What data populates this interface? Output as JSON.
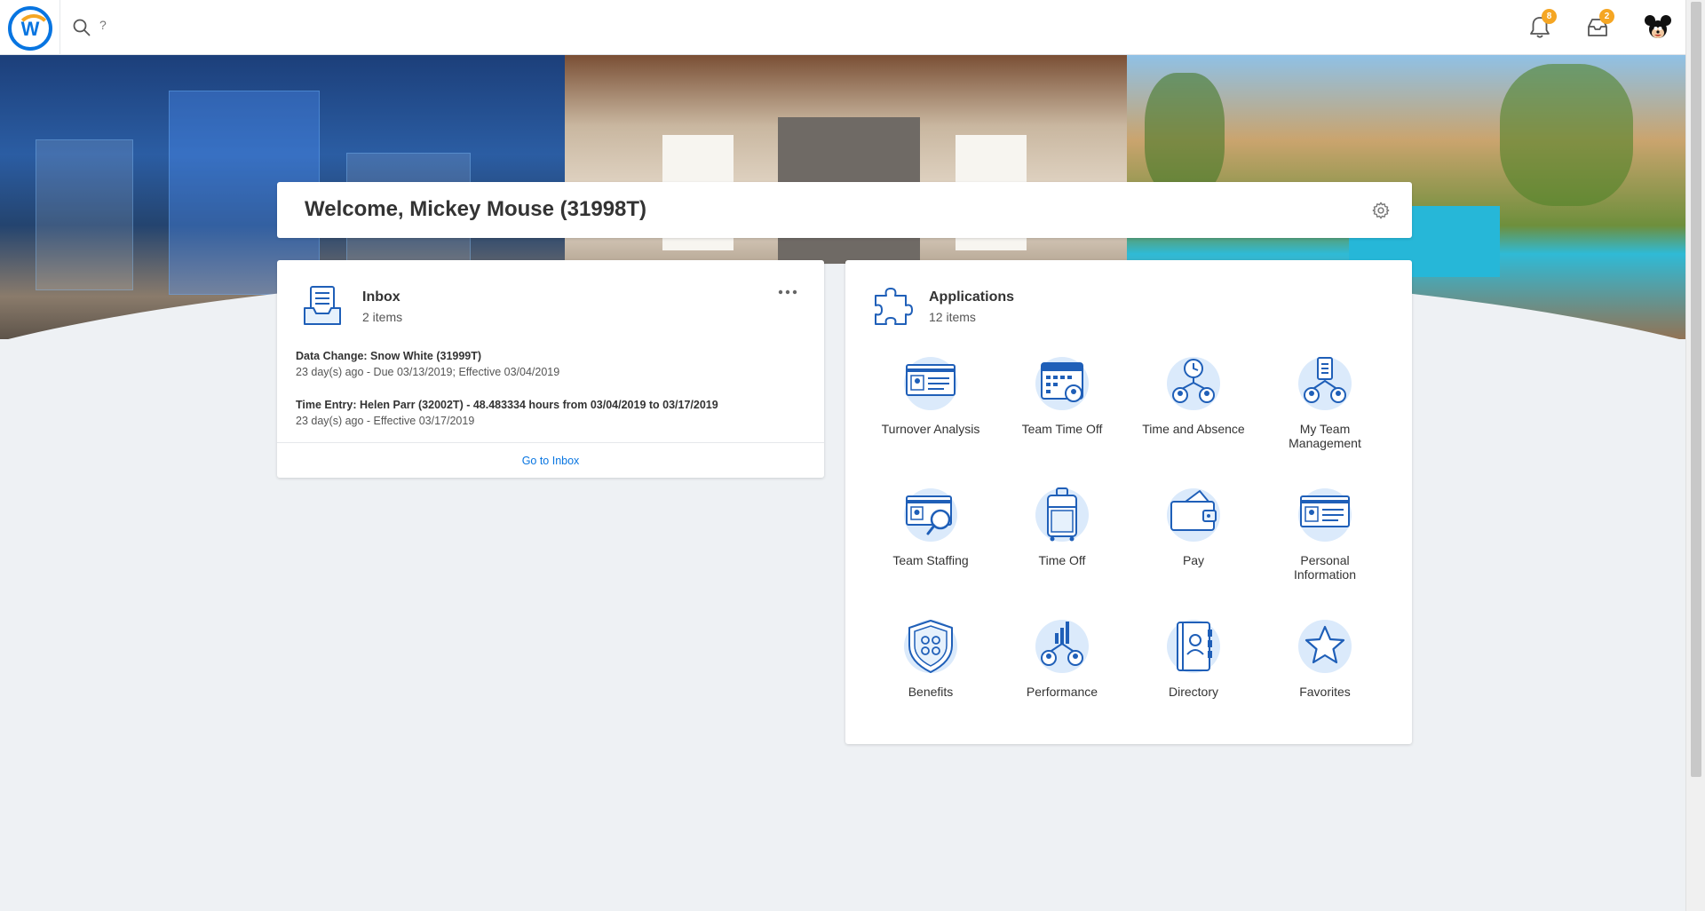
{
  "header": {
    "logo_letter": "W",
    "search_placeholder": "?",
    "notifications_count": "8",
    "inbox_count": "2"
  },
  "welcome": {
    "title": "Welcome, Mickey Mouse (31998T)"
  },
  "inbox": {
    "title": "Inbox",
    "subtitle": "2 items",
    "items": [
      {
        "title": "Data Change: Snow White (31999T)",
        "detail": "23 day(s) ago - Due 03/13/2019; Effective 03/04/2019"
      },
      {
        "title": "Time Entry: Helen Parr (32002T) - 48.483334 hours from 03/04/2019 to 03/17/2019",
        "detail": "23 day(s) ago - Effective 03/17/2019"
      }
    ],
    "footer_link": "Go to Inbox"
  },
  "applications": {
    "title": "Applications",
    "subtitle": "12 items",
    "tiles": [
      {
        "label": "Turnover Analysis",
        "icon": "turnover-analysis-icon"
      },
      {
        "label": "Team Time Off",
        "icon": "team-time-off-icon"
      },
      {
        "label": "Time and Absence",
        "icon": "time-and-absence-icon"
      },
      {
        "label": "My Team Management",
        "icon": "my-team-management-icon"
      },
      {
        "label": "Team Staffing",
        "icon": "team-staffing-icon"
      },
      {
        "label": "Time Off",
        "icon": "time-off-icon"
      },
      {
        "label": "Pay",
        "icon": "pay-icon"
      },
      {
        "label": "Personal Information",
        "icon": "personal-information-icon"
      },
      {
        "label": "Benefits",
        "icon": "benefits-icon"
      },
      {
        "label": "Performance",
        "icon": "performance-icon"
      },
      {
        "label": "Directory",
        "icon": "directory-icon"
      },
      {
        "label": "Favorites",
        "icon": "favorites-icon"
      }
    ]
  },
  "colors": {
    "accent": "#0875e1",
    "badge": "#f5a623",
    "page_bg": "#eef1f4"
  }
}
